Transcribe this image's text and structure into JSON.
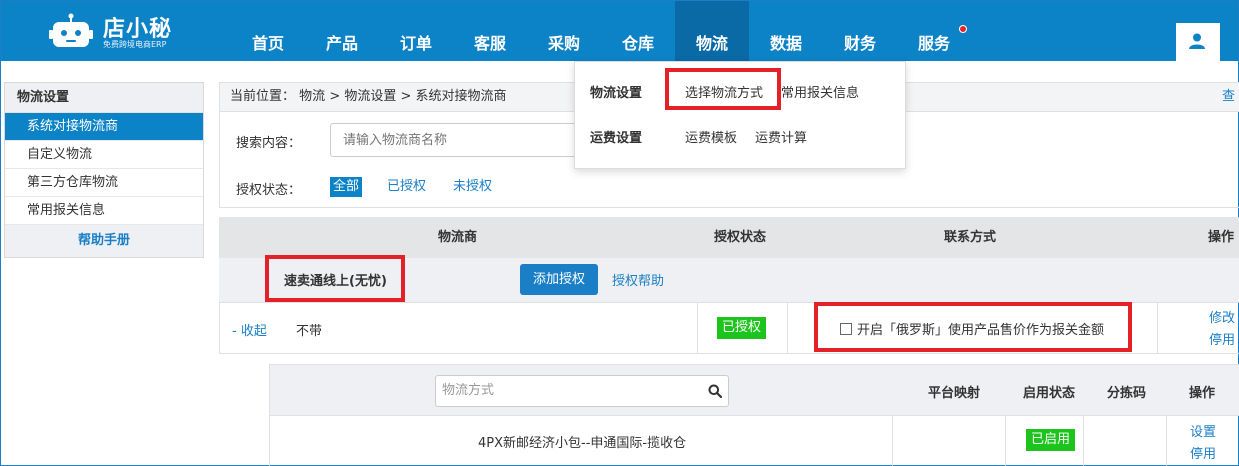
{
  "app": {
    "logo_title": "店小秘",
    "logo_subtitle": "免费跨境电商ERP"
  },
  "nav": {
    "items": [
      "首页",
      "产品",
      "订单",
      "客服",
      "采购",
      "仓库",
      "物流",
      "数据",
      "财务",
      "服务"
    ],
    "active": "物流"
  },
  "dropdown": {
    "group1_label": "物流设置",
    "group1_links": [
      "选择物流方式",
      "常用报关信息"
    ],
    "group2_label": "运费设置",
    "group2_links": [
      "运费模板",
      "运费计算"
    ]
  },
  "sidebar": {
    "title": "物流设置",
    "items": [
      "系统对接物流商",
      "自定义物流",
      "第三方仓库物流",
      "常用报关信息"
    ],
    "help": "帮助手册"
  },
  "breadcrumb": {
    "prefix": "当前位置：",
    "path1": "物流",
    "sep": " > ",
    "path2": "物流设置",
    "path3": "系统对接物流商",
    "right_link": "查"
  },
  "filter": {
    "search_label": "搜索内容：",
    "search_placeholder": "请输入物流商名称",
    "auth_label": "授权状态：",
    "auth_tabs": [
      "全部",
      "已授权",
      "未授权"
    ]
  },
  "table": {
    "headers": [
      "物流商",
      "授权状态",
      "联系方式",
      "操作"
    ],
    "provider_name": "速卖通线上(无忧)",
    "add_auth_button": "添加授权",
    "auth_help_link": "授权帮助",
    "collapse_link": "- 收起",
    "no_text": "不带",
    "auth_status": "已授权",
    "checkbox_label": "开启「俄罗斯」使用产品售价作为报关金额",
    "op_links": [
      "修改",
      "停用"
    ]
  },
  "subtable": {
    "method_placeholder": "物流方式",
    "headers": [
      "平台映射",
      "启用状态",
      "分拣码",
      "操作"
    ],
    "rows": [
      {
        "name": "4PX新邮经济小包--申通国际-揽收仓",
        "status": "已启用",
        "ops": [
          "设置",
          "停用"
        ]
      }
    ]
  },
  "colors": {
    "brand_blue": "#0c82c7",
    "highlight_red": "#e42029",
    "status_green": "#1ec41e"
  }
}
